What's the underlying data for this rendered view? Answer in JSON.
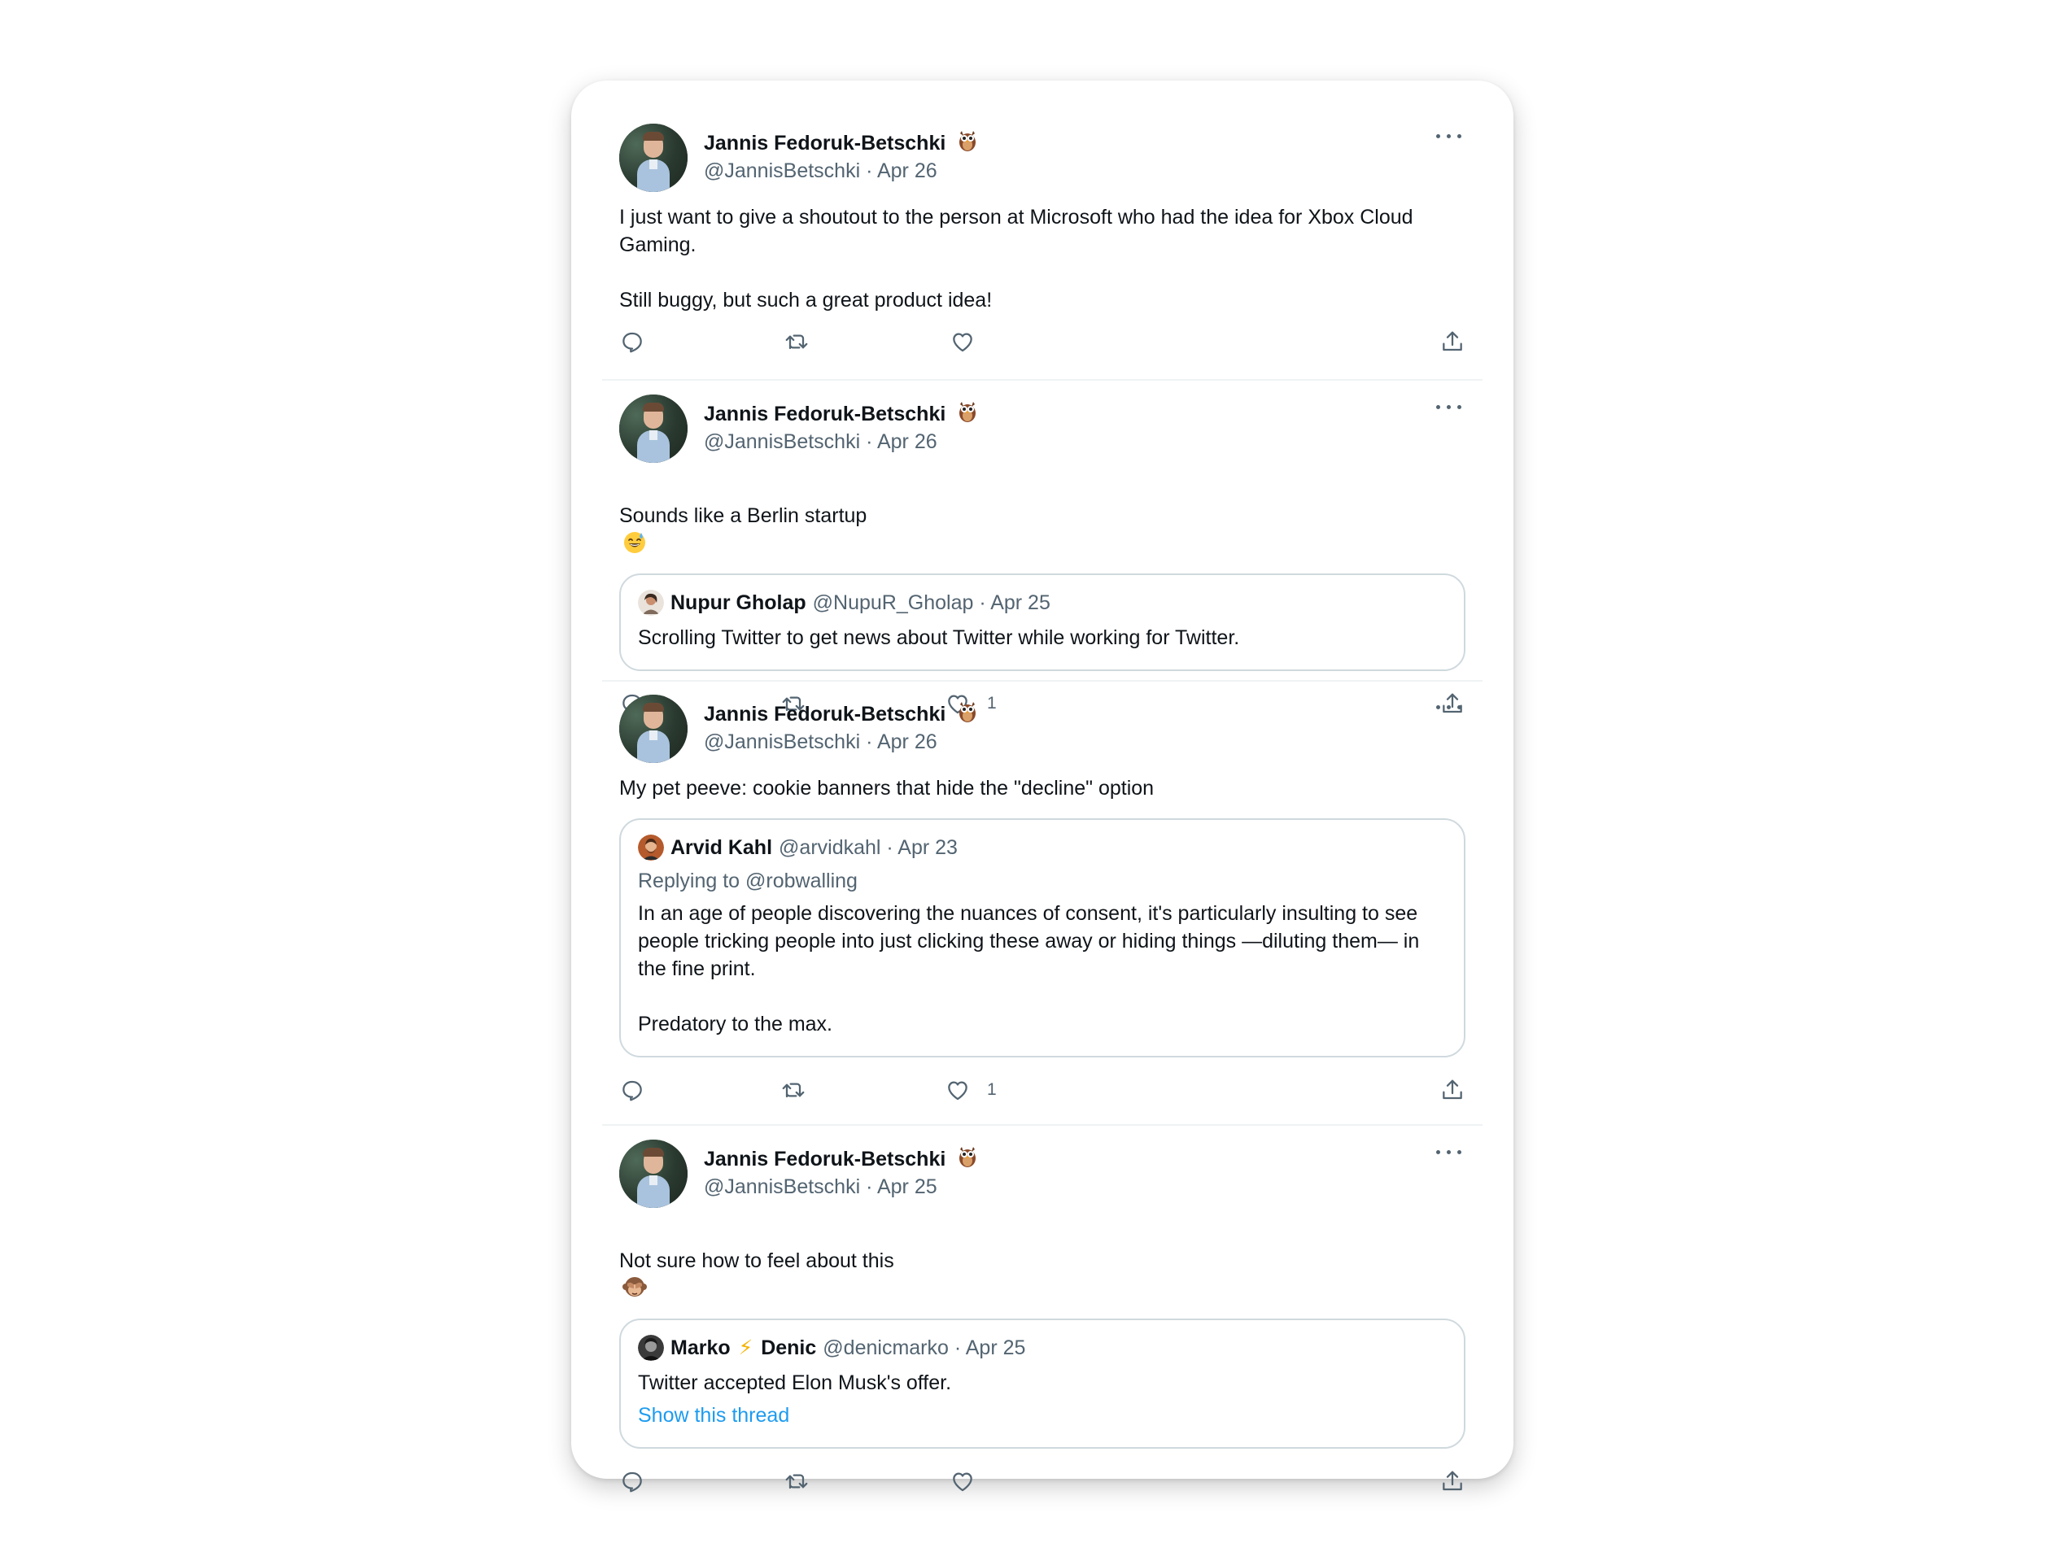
{
  "author": {
    "name": "Jannis Fedoruk-Betschki",
    "handle": "@JannisBetschki",
    "badge_emoji": "owl-icon"
  },
  "colors": {
    "text": "#0f1419",
    "secondary": "#536471",
    "link": "#1d9bf0",
    "border": "#cfd9de",
    "divider": "#eff3f4"
  },
  "tweets": [
    {
      "author_name": "Jannis Fedoruk-Betschki",
      "meta": "@JannisBetschki · Apr 26",
      "text": "I just want to give a shoutout to the person at Microsoft who had the idea for Xbox Cloud\nGaming.\n\nStill buggy, but such a great product idea!",
      "likes": ""
    },
    {
      "author_name": "Jannis Fedoruk-Betschki",
      "meta": "@JannisBetschki · Apr 26",
      "text": "Sounds like a Berlin startup",
      "text_emoji": "😅",
      "likes": "1",
      "quote": {
        "name": "Nupur Gholap",
        "meta": "@NupuR_Gholap · Apr 25",
        "text": "Scrolling Twitter to get news about Twitter while working for Twitter."
      }
    },
    {
      "author_name": "Jannis Fedoruk-Betschki",
      "meta": "@JannisBetschki · Apr 26",
      "text": "My pet peeve: cookie banners that hide the \"decline\" option",
      "likes": "1",
      "quote": {
        "name": "Arvid Kahl",
        "meta": "@arvidkahl · Apr 23",
        "replying": "Replying to @robwalling",
        "text": "In an age of people discovering the nuances of consent, it's particularly insulting to see\npeople tricking people into just clicking these away or hiding things —diluting them— in\nthe fine print.\n\nPredatory to the max."
      }
    },
    {
      "author_name": "Jannis Fedoruk-Betschki",
      "meta": "@JannisBetschki · Apr 25",
      "text": "Not sure how to feel about this",
      "text_emoji": "🙈",
      "likes": "",
      "quote": {
        "name_first": "Marko",
        "name_bolt": "⚡",
        "name_last": "Denic",
        "meta": "@denicmarko · Apr 25",
        "text": "Twitter accepted Elon Musk's offer.",
        "link": "Show this thread"
      }
    }
  ]
}
